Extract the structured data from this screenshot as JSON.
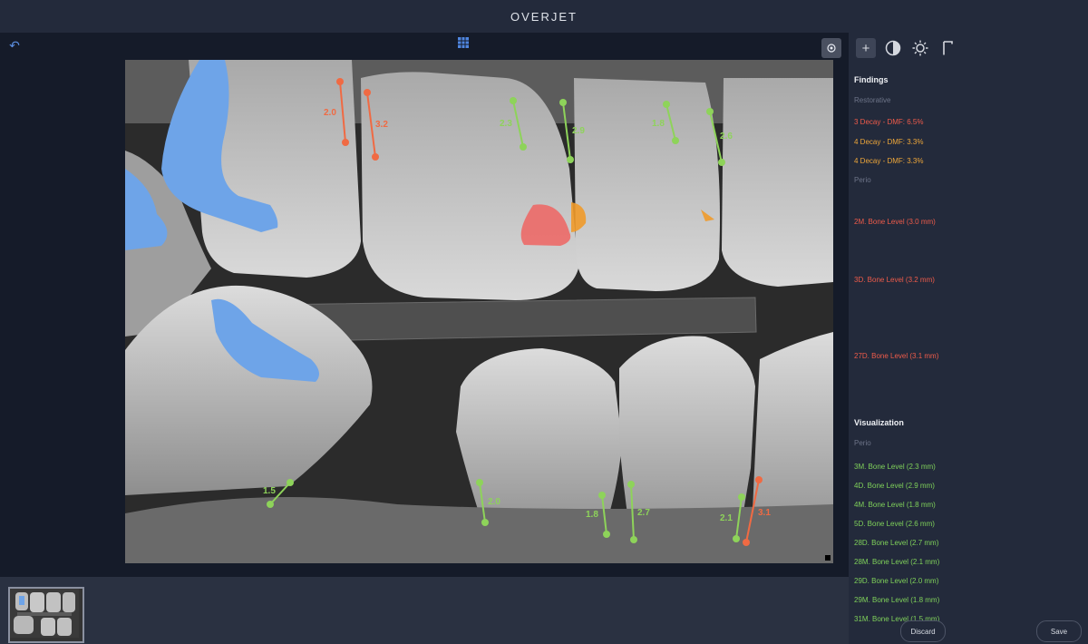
{
  "app": {
    "title": "OVERJET"
  },
  "viewer": {
    "back_icon": "arrow-back-icon",
    "grid_icon": "grid-icon",
    "target_icon": "crosshair-icon",
    "measurements": [
      {
        "label": "2.0",
        "color": "#f06a43"
      },
      {
        "label": "3.2",
        "color": "#f06a43"
      },
      {
        "label": "2.3",
        "color": "#8ed35a"
      },
      {
        "label": "2.9",
        "color": "#8ed35a"
      },
      {
        "label": "1.8",
        "color": "#8ed35a"
      },
      {
        "label": "2.6",
        "color": "#8ed35a"
      },
      {
        "label": "1.5",
        "color": "#8ed35a"
      },
      {
        "label": "2.0",
        "color": "#8ed35a"
      },
      {
        "label": "1.8",
        "color": "#8ed35a"
      },
      {
        "label": "2.7",
        "color": "#8ed35a"
      },
      {
        "label": "2.1",
        "color": "#8ed35a"
      },
      {
        "label": "3.1",
        "color": "#f06a43"
      }
    ]
  },
  "toolbar": {
    "tools": [
      {
        "name": "add-icon"
      },
      {
        "name": "contrast-icon"
      },
      {
        "name": "brightness-icon"
      },
      {
        "name": "gamma-icon"
      }
    ]
  },
  "findings": {
    "title": "Findings",
    "restorative_label": "Restorative",
    "restorative": [
      {
        "text": "3 Decay - DMF: 6.5%"
      },
      {
        "text": "4 Decay - DMF: 3.3%"
      },
      {
        "text": "4 Decay - DMF: 3.3%"
      }
    ],
    "perio_label": "Perio",
    "perio": [
      {
        "text": "2M. Bone Level (3.0 mm)"
      },
      {
        "text": "3D. Bone Level (3.2 mm)"
      },
      {
        "text": "27D. Bone Level (3.1 mm)"
      }
    ]
  },
  "visualization": {
    "title": "Visualization",
    "perio_label": "Perio",
    "items": [
      {
        "text": "3M. Bone Level (2.3 mm)"
      },
      {
        "text": "4D. Bone Level (2.9 mm)"
      },
      {
        "text": "4M. Bone Level (1.8 mm)"
      },
      {
        "text": "5D. Bone Level (2.6 mm)"
      },
      {
        "text": "28D. Bone Level (2.7 mm)"
      },
      {
        "text": "28M. Bone Level (2.1 mm)"
      },
      {
        "text": "29D. Bone Level (2.0 mm)"
      },
      {
        "text": "29M. Bone Level (1.8 mm)"
      },
      {
        "text": "31M. Bone Level (1.5 mm)"
      }
    ]
  },
  "actions": {
    "discard_label": "Discard",
    "save_label": "Save"
  },
  "colors": {
    "red": "#ee5b4a",
    "orange": "#eda63a",
    "green": "#7fd15a",
    "restoration_blue": "#6ea4e8"
  }
}
